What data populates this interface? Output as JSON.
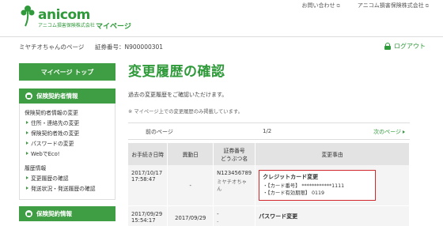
{
  "header": {
    "brand": "anicom",
    "company": "アニコム損害保険株式会社",
    "mypage": "マイページ",
    "links": [
      {
        "label": "お問い合わせ",
        "ext": "⧉"
      },
      {
        "label": "アニコム損害保険株式会社",
        "ext": "⧉"
      }
    ]
  },
  "info": {
    "pet_page": "ミヤチオちゃんのページ",
    "cert_label": "証券番号：N900000301",
    "logout": "ログアウト"
  },
  "sidebar": {
    "top_button": "マイページ トップ",
    "section1": {
      "heading": "保険契約者情報",
      "group1": "保険契約者情報の変更",
      "links1": [
        "住所・連絡先の変更",
        "保険契約者姓の変更",
        "パスワードの変更",
        "WebでEco!"
      ],
      "group2": "履歴情報",
      "links2": [
        "変更履歴の確認",
        "発送状況・発送履歴の確認"
      ]
    },
    "section2": {
      "heading": "保険契約情報"
    }
  },
  "main": {
    "title": "変更履歴の確認",
    "intro": "過去の変更履歴をご確認いただけます。",
    "note": "※ マイページ上での変更履歴のみ掲載しています。"
  },
  "pager": {
    "prev": "前のページ",
    "count": "1/2",
    "next": "次のページ"
  },
  "table": {
    "headers": [
      "お手続き日時",
      "異動日",
      "証券番号\nどうぶつ名",
      "変更事由"
    ],
    "rows": [
      {
        "datetime": "2017/10/17 17:58:47",
        "change_date": "-",
        "cert_no": "N123456789",
        "animal": "ミヤチオちゃん",
        "reason_title": "クレジットカード変更",
        "reason_lines": [
          "・【カード番号】 ************1111",
          "・【カード有効期限】 0119"
        ]
      },
      {
        "datetime": "2017/09/29 15:54:17",
        "change_date": "2017/09/29",
        "cert_no": "-",
        "animal": "-",
        "reason_title": "パスワード変更"
      }
    ]
  },
  "colors": {
    "brand_green": "#2f9a3a",
    "sidebar_green": "#3f9e43",
    "highlight_red": "#d0262c"
  }
}
